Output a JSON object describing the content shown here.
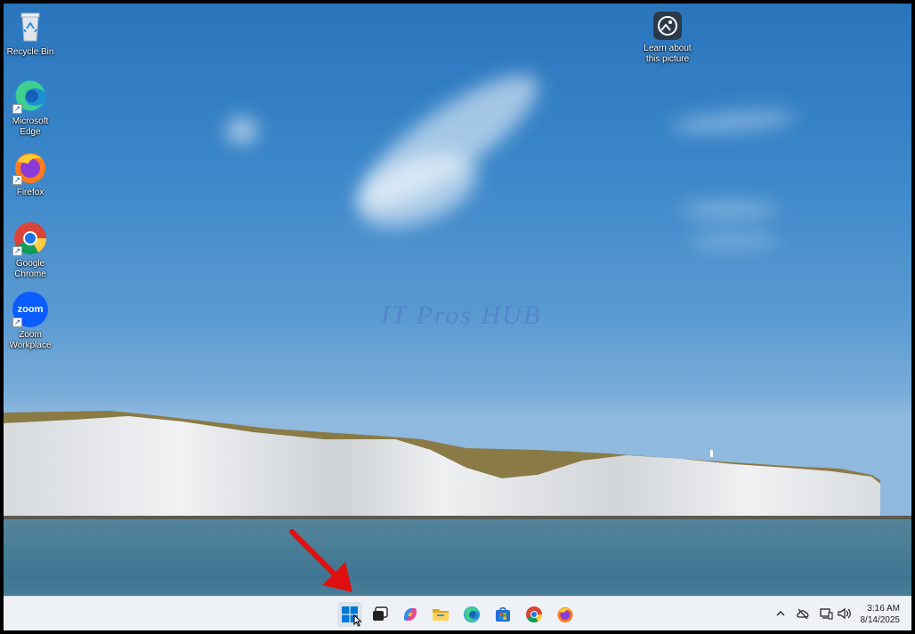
{
  "desktop": {
    "icons": [
      {
        "label": "Recycle Bin",
        "icon": "recycle-bin-icon"
      },
      {
        "label": "Microsoft Edge",
        "icon": "edge-icon"
      },
      {
        "label": "Firefox",
        "icon": "firefox-icon"
      },
      {
        "label": "Google Chrome",
        "icon": "chrome-icon"
      },
      {
        "label": "Zoom Workplace",
        "icon": "zoom-icon"
      }
    ],
    "spotlight": {
      "label": "Learn about this picture",
      "icon": "learn-about-picture-icon"
    },
    "zoom_icon_text": "zoom",
    "watermark": "IT Pros HUB"
  },
  "taskbar": {
    "apps": [
      {
        "name": "Start",
        "icon": "windows-start-icon",
        "active": true
      },
      {
        "name": "Task View",
        "icon": "task-view-icon"
      },
      {
        "name": "Copilot",
        "icon": "copilot-icon"
      },
      {
        "name": "File Explorer",
        "icon": "file-explorer-icon"
      },
      {
        "name": "Microsoft Edge",
        "icon": "edge-icon"
      },
      {
        "name": "Microsoft Store",
        "icon": "store-icon"
      },
      {
        "name": "Google Chrome",
        "icon": "chrome-icon"
      },
      {
        "name": "Firefox",
        "icon": "firefox-icon"
      }
    ],
    "tray": {
      "icons": [
        "show-hidden-icons-chevron",
        "onedrive-cloud-offline-icon",
        "network-icon",
        "volume-icon"
      ],
      "time": "3:16 AM",
      "date": "8/14/2025"
    }
  },
  "annotation": {
    "arrow_color": "#e01010"
  },
  "colors": {
    "windows_blue": "#0078d4",
    "taskbar_bg": "#eef2f7"
  }
}
